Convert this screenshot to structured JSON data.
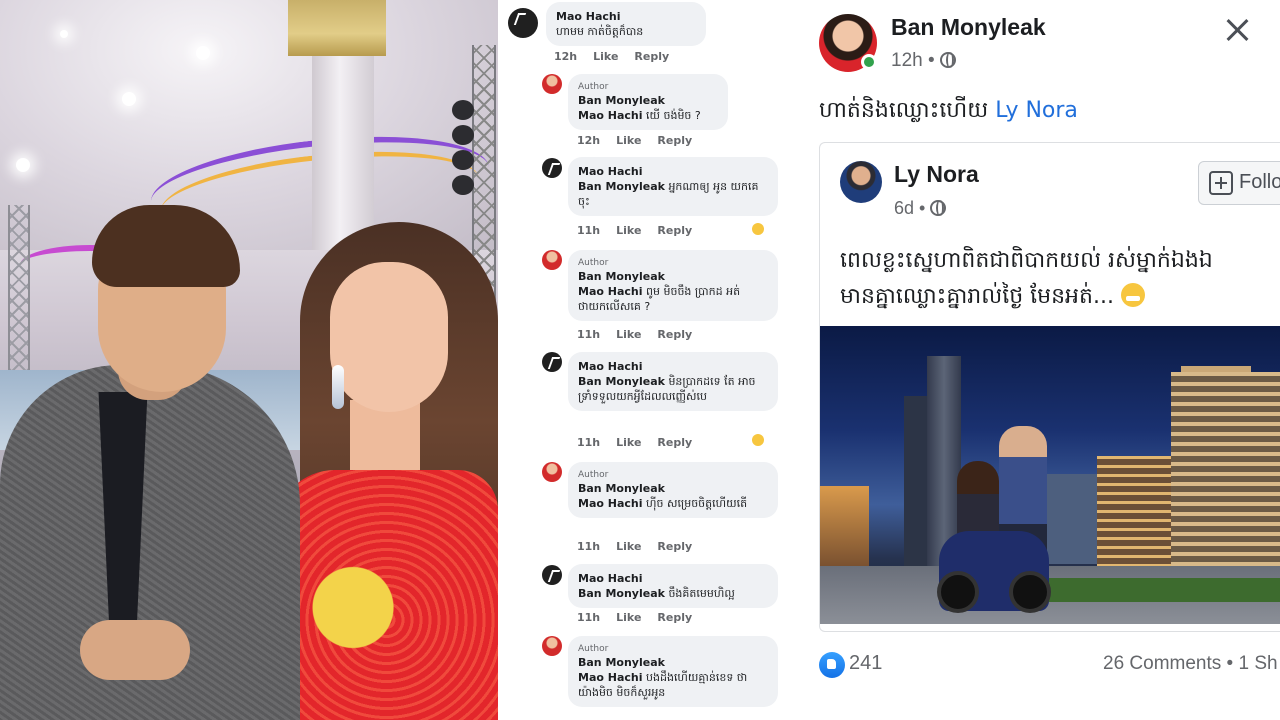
{
  "comments": [
    {
      "name": "Mao Hachi",
      "author": "",
      "mention": "",
      "text": "ហាមម កាត់ចិត្តក៏បាន",
      "time": "12h",
      "like": "Like",
      "reply": "Reply"
    },
    {
      "name": "Ban Monyleak",
      "author": "Author",
      "mention": "Mao Hachi",
      "text": "យើ ចង់មិច ?",
      "time": "12h",
      "like": "Like",
      "reply": "Reply"
    },
    {
      "name": "Mao Hachi",
      "author": "",
      "mention": "Ban Monyleak",
      "text": "អ្នកណាឲ្យ អូន យកគេចុះ",
      "time": "11h",
      "like": "Like",
      "reply": "Reply"
    },
    {
      "name": "Ban Monyleak",
      "author": "Author",
      "mention": "Mao Hachi",
      "text": "ពូម មិចចឹង ប្រាកដ អត់ ថាយកលើសគេ ?",
      "time": "11h",
      "like": "Like",
      "reply": "Reply"
    },
    {
      "name": "Mao Hachi",
      "author": "",
      "mention": "Ban Monyleak",
      "text": "មិនប្រាកដទេ តែ អាចទ្រាំទទួលយកអ្វីដែលលញ្ញើស់បេ",
      "time": "11h",
      "like": "Like",
      "reply": "Reply"
    },
    {
      "name": "Ban Monyleak",
      "author": "Author",
      "mention": "Mao Hachi",
      "text": "ហ៊ីច សម្រេចចិត្តហើយតើ",
      "time": "11h",
      "like": "Like",
      "reply": "Reply"
    },
    {
      "name": "Mao Hachi",
      "author": "",
      "mention": "Ban Monyleak",
      "text": "ចឹងគិតមេមហិល្អ",
      "time": "11h",
      "like": "Like",
      "reply": "Reply"
    },
    {
      "name": "Ban Monyleak",
      "author": "Author",
      "mention": "Mao Hachi",
      "text": "បងដឹងហើយគ្មាន់ខេទ ថាយ៉ាងមិច មិចក៏សួរអូន",
      "time": "",
      "like": "",
      "reply": ""
    }
  ],
  "post": {
    "author": "Ban Monyleak",
    "time": "12h",
    "dot": "•",
    "text": "ហាត់និងឈ្លោះហើយ",
    "tag": "Ly Nora",
    "shared": {
      "author": "Ly Nora",
      "time": "6d",
      "follow": "Follow",
      "line1": "ពេលខ្លះស្នេហាពិតជាពិបាកយល់ រស់ម្នាក់ឯងឯ",
      "line2": "មានគ្នាឈ្លោះគ្នារាល់ថ្ងៃ មែនអត់..."
    },
    "likes": "241",
    "comments_shares": "26 Comments • 1 Sh"
  },
  "colors": {
    "link": "#216fdb",
    "like": "#1877f2",
    "online": "#31a24c"
  },
  "icons": [
    "close-icon",
    "globe-icon",
    "like-icon",
    "follow-icon",
    "grin-emoji"
  ]
}
